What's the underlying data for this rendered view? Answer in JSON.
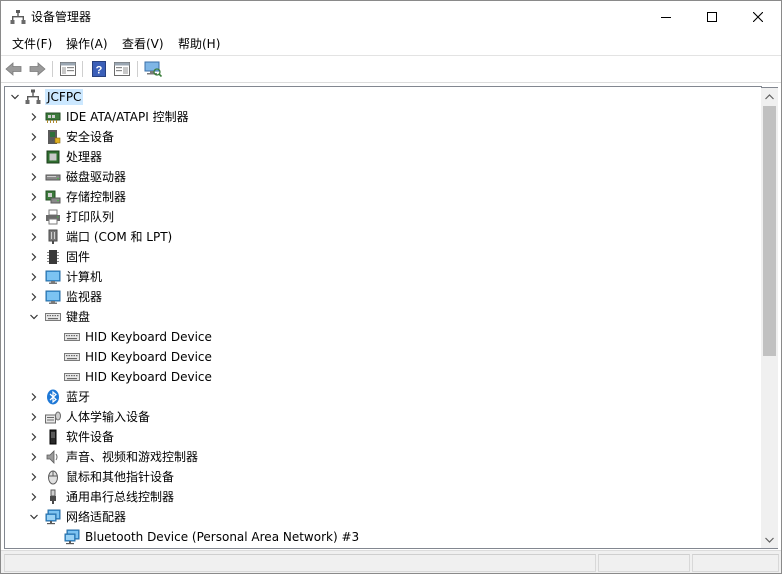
{
  "window": {
    "title": "设备管理器",
    "minimize_icon": "minimize-icon",
    "maximize_icon": "maximize-icon",
    "close_icon": "close-icon"
  },
  "menu": [
    {
      "label": "文件(F)"
    },
    {
      "label": "操作(A)"
    },
    {
      "label": "查看(V)"
    },
    {
      "label": "帮助(H)"
    }
  ],
  "toolbar": {
    "icons": [
      "back-arrow-icon",
      "forward-arrow-icon",
      "show-hide-console-tree-icon",
      "help-icon",
      "properties-pane-icon",
      "scan-hardware-icon"
    ]
  },
  "tree": {
    "root": {
      "label": "JCFPC",
      "icon": "computer-icon",
      "expanded": true
    },
    "items": [
      {
        "label": "IDE ATA/ATAPI 控制器",
        "icon": "ide-controller-icon",
        "level": 1,
        "chevron": "right"
      },
      {
        "label": "安全设备",
        "icon": "security-device-icon",
        "level": 1,
        "chevron": "right"
      },
      {
        "label": "处理器",
        "icon": "processor-icon",
        "level": 1,
        "chevron": "right"
      },
      {
        "label": "磁盘驱动器",
        "icon": "disk-drive-icon",
        "level": 1,
        "chevron": "right"
      },
      {
        "label": "存储控制器",
        "icon": "storage-controller-icon",
        "level": 1,
        "chevron": "right"
      },
      {
        "label": "打印队列",
        "icon": "printer-icon",
        "level": 1,
        "chevron": "right"
      },
      {
        "label": "端口 (COM 和 LPT)",
        "icon": "port-icon",
        "level": 1,
        "chevron": "right"
      },
      {
        "label": "固件",
        "icon": "firmware-icon",
        "level": 1,
        "chevron": "right"
      },
      {
        "label": "计算机",
        "icon": "monitor-icon",
        "level": 1,
        "chevron": "right"
      },
      {
        "label": "监视器",
        "icon": "monitor-icon",
        "level": 1,
        "chevron": "right"
      },
      {
        "label": "键盘",
        "icon": "keyboard-icon",
        "level": 1,
        "chevron": "down"
      },
      {
        "label": "HID Keyboard Device",
        "icon": "keyboard-icon",
        "level": 2,
        "chevron": "none"
      },
      {
        "label": "HID Keyboard Device",
        "icon": "keyboard-icon",
        "level": 2,
        "chevron": "none"
      },
      {
        "label": "HID Keyboard Device",
        "icon": "keyboard-icon",
        "level": 2,
        "chevron": "none"
      },
      {
        "label": "蓝牙",
        "icon": "bluetooth-icon",
        "level": 1,
        "chevron": "right"
      },
      {
        "label": "人体学输入设备",
        "icon": "hid-icon",
        "level": 1,
        "chevron": "right"
      },
      {
        "label": "软件设备",
        "icon": "software-device-icon",
        "level": 1,
        "chevron": "right"
      },
      {
        "label": "声音、视频和游戏控制器",
        "icon": "speaker-icon",
        "level": 1,
        "chevron": "right"
      },
      {
        "label": "鼠标和其他指针设备",
        "icon": "mouse-icon",
        "level": 1,
        "chevron": "right"
      },
      {
        "label": "通用串行总线控制器",
        "icon": "usb-icon",
        "level": 1,
        "chevron": "right"
      },
      {
        "label": "网络适配器",
        "icon": "network-adapter-icon",
        "level": 1,
        "chevron": "down"
      },
      {
        "label": "Bluetooth Device (Personal Area Network) #3",
        "icon": "network-adapter-icon",
        "level": 2,
        "chevron": "none"
      }
    ]
  },
  "scrollbar": {
    "position_fraction": 0.0
  }
}
